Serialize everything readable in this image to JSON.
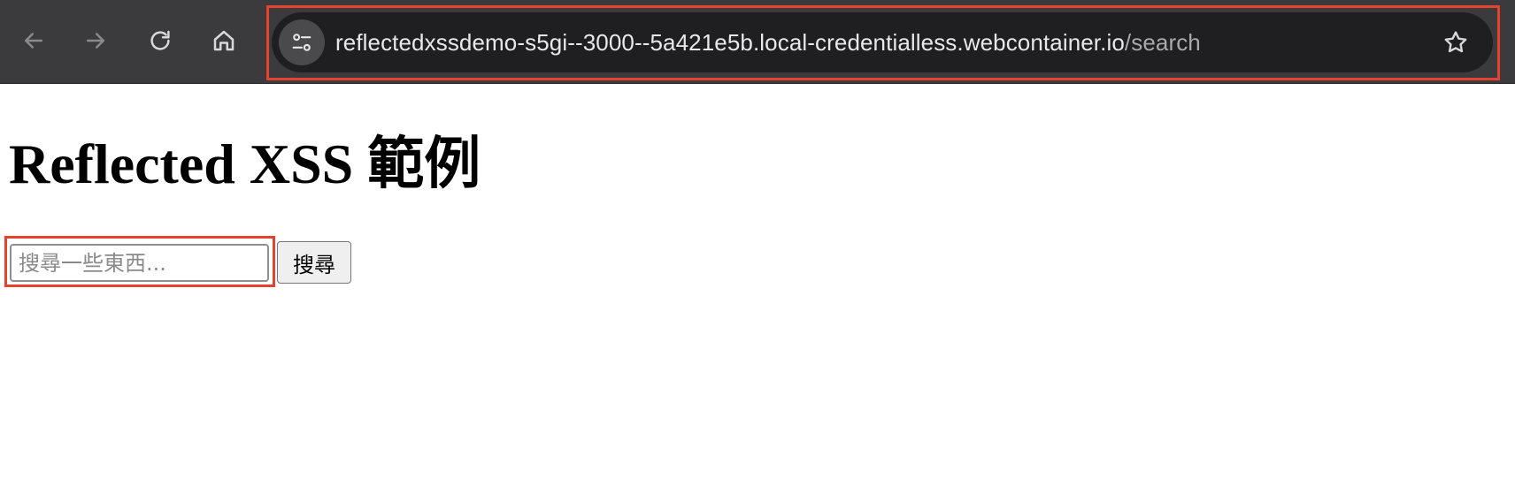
{
  "browser": {
    "url_host": "reflectedxssdemo-s5gi--3000--5a421e5b.local-credentialless.webcontainer.io",
    "url_path": "/search",
    "icons": {
      "back": "arrow-left-icon",
      "forward": "arrow-right-icon",
      "reload": "reload-icon",
      "home": "home-icon",
      "site_info": "tune-icon",
      "bookmark": "star-icon"
    },
    "highlight_color": "#e5432d"
  },
  "page": {
    "title": "Reflected XSS 範例",
    "search": {
      "placeholder": "搜尋一些東西...",
      "value": "",
      "button_label": "搜尋"
    }
  }
}
